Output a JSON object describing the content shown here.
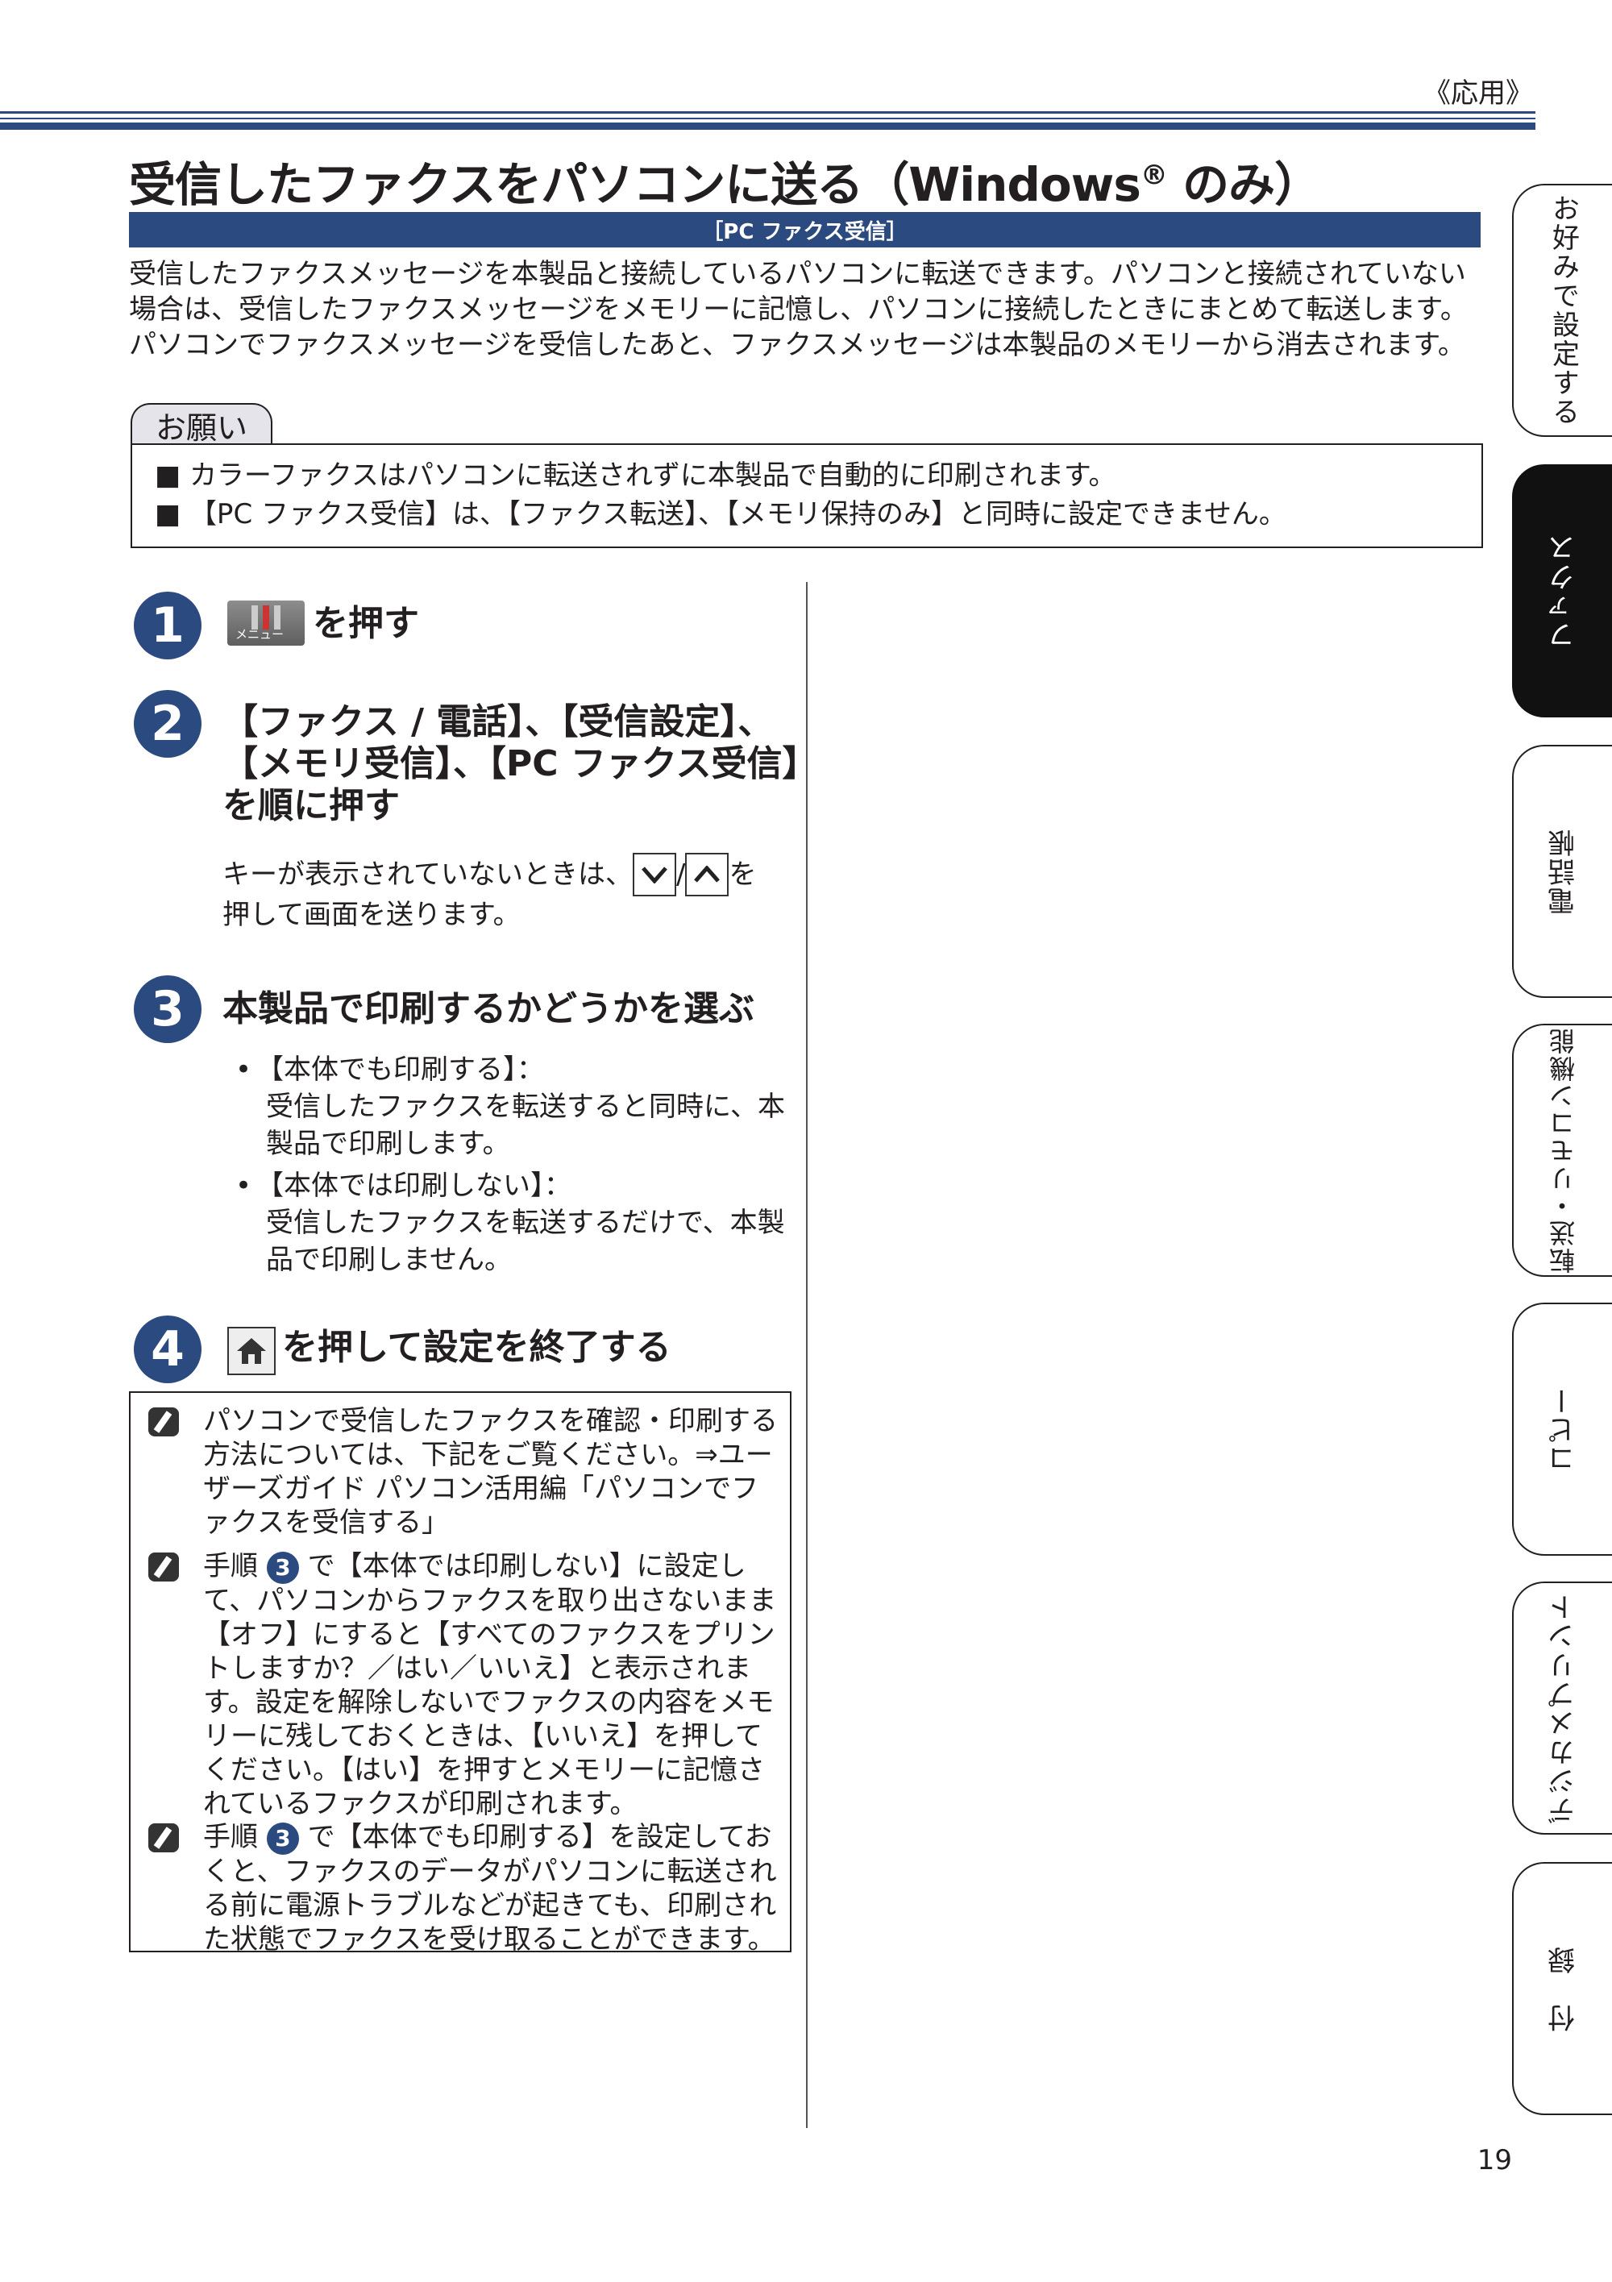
{
  "header": {
    "section_label": "《応用》"
  },
  "title": {
    "main": "受信したファクスをパソコンに送る（Windows",
    "registered": "®",
    "suffix": " のみ）"
  },
  "banner": "［PC ファクス受信］",
  "intro": "受信したファクスメッセージを本製品と接続しているパソコンに転送できます。パソコンと接続されていない場合は、受信したファクスメッセージをメモリーに記憶し、パソコンに接続したときにまとめて転送します。パソコンでファクスメッセージを受信したあと、ファクスメッセージは本製品のメモリーから消去されます。",
  "note": {
    "tab_label": "お願い",
    "items": [
      "カラーファクスはパソコンに転送されずに本製品で自動的に印刷されます。",
      "【PC ファクス受信】は、【ファクス転送】、【メモリ保持のみ】と同時に設定できません。"
    ]
  },
  "steps": [
    {
      "num": "1",
      "text": "を押す",
      "icon_label": "メニュー"
    },
    {
      "num": "2",
      "lines": [
        "【ファクス / 電話】、【受信設定】、",
        "【メモリ受信】、【PC ファクス受信】",
        "を順に押す"
      ],
      "hint_a": "キーが表示されていないときは、",
      "hint_sep": "/",
      "hint_b": " を",
      "hint_c": "押して画面を送ります。"
    },
    {
      "num": "3",
      "text": "本製品で印刷するかどうかを選ぶ",
      "options": [
        {
          "label": "【本体でも印刷する】：",
          "desc_1": "受信したファクスを転送すると同時に、本",
          "desc_2": "製品で印刷します。"
        },
        {
          "label": "【本体では印刷しない】：",
          "desc_1": "受信したファクスを転送するだけで、本製",
          "desc_2": "品で印刷しません。"
        }
      ]
    },
    {
      "num": "4",
      "text": "を押して設定を終了する"
    }
  ],
  "memos": [
    "パソコンで受信したファクスを確認・印刷する方法については、下記をご覧ください。⇒ユーザーズガイド パソコン活用編「パソコンでファクスを受信する」",
    {
      "pre": "手順 ",
      "num": "3",
      "post": " で【本体では印刷しない】に設定して、パソコンからファクスを取り出さないまま【オフ】にすると【すべてのファクスをプリントしますか？／はい／いいえ】と表示されます。設定を解除しないでファクスの内容をメモリーに残しておくときは、【いいえ】を押してください。【はい】を押すとメモリーに記憶されているファクスが印刷されます。"
    },
    {
      "pre": "手順 ",
      "num": "3",
      "post": " で【本体でも印刷する】を設定しておくと、ファクスのデータがパソコンに転送される前に電源トラブルなどが起きても、印刷された状態でファクスを受け取ることができます。"
    }
  ],
  "side_tabs": [
    "お好みで設定する",
    "ファクス",
    "電話帳",
    "転送・",
    "リモコン機能",
    "コピー",
    "デジカメプリント",
    "付　録"
  ],
  "page_number": "19",
  "colors": {
    "accent": "#2b4a80",
    "active_tab": "#111111"
  }
}
